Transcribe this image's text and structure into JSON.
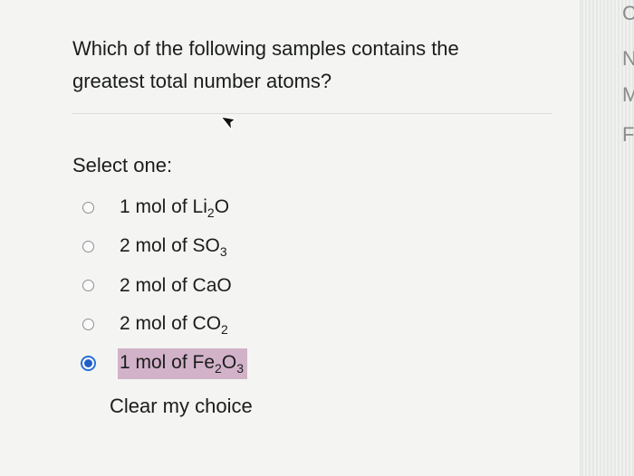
{
  "question": {
    "line1": "Which of the following samples contains the",
    "line2": "greatest total number atoms?"
  },
  "select_label": "Select one:",
  "options": [
    {
      "prefix": "1 mol of Li",
      "sub1": "2",
      "mid": "O",
      "sub2": "",
      "selected": false
    },
    {
      "prefix": "2 mol of SO",
      "sub1": "3",
      "mid": "",
      "sub2": "",
      "selected": false
    },
    {
      "prefix": "2 mol of CaO",
      "sub1": "",
      "mid": "",
      "sub2": "",
      "selected": false
    },
    {
      "prefix": "2 mol of CO",
      "sub1": "2",
      "mid": "",
      "sub2": "",
      "selected": false
    },
    {
      "prefix": "1 mol of Fe",
      "sub1": "2",
      "mid": "O",
      "sub2": "3",
      "selected": true
    }
  ],
  "clear_label": "Clear my choice",
  "right_edge_glyphs": [
    "C",
    "N",
    "M",
    "F"
  ],
  "colors": {
    "selected_highlight": "#d2b2c9",
    "radio_accent": "#1f5fc9"
  }
}
